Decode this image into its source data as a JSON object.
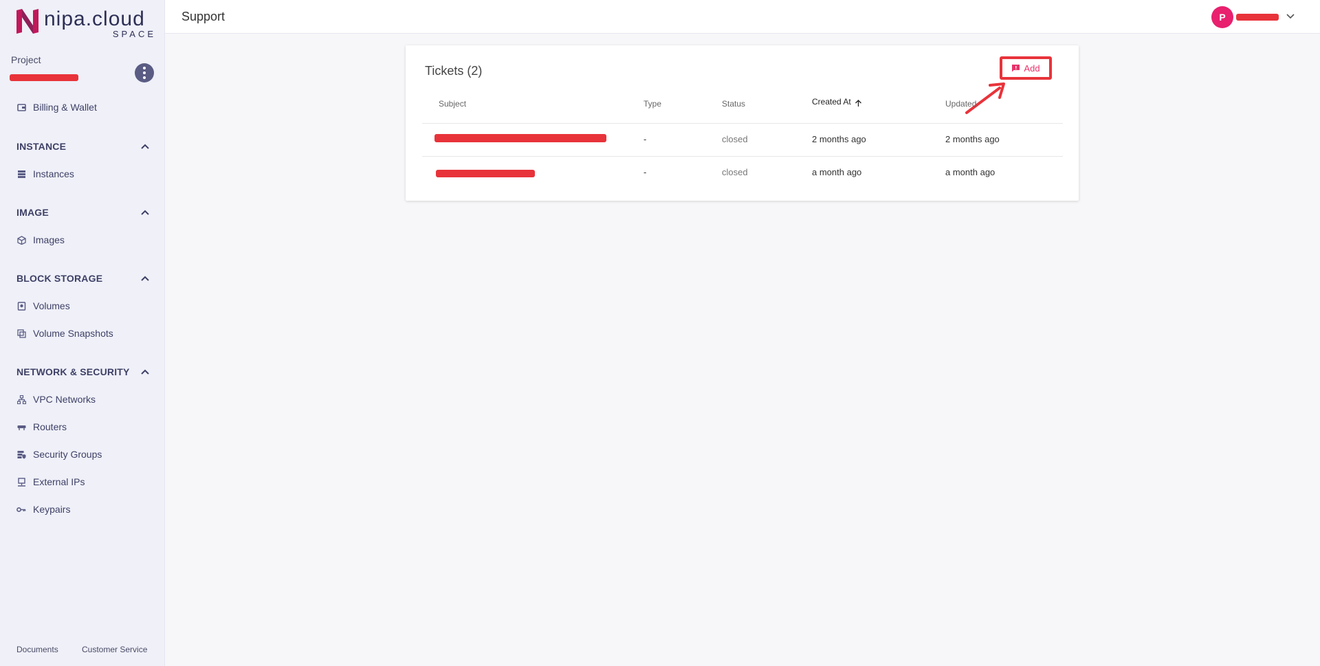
{
  "brand": {
    "name": "nipa.cloud",
    "sub": "SPACE",
    "colors": {
      "accent": "#e8206e",
      "nav": "#3e4066",
      "redaction": "#e8333a"
    }
  },
  "project": {
    "label": "Project"
  },
  "sidebar": {
    "top_items": [
      {
        "label": "Billing & Wallet",
        "icon": "wallet-icon"
      }
    ],
    "sections": [
      {
        "title": "INSTANCE",
        "items": [
          {
            "label": "Instances",
            "icon": "server-icon"
          }
        ]
      },
      {
        "title": "IMAGE",
        "items": [
          {
            "label": "Images",
            "icon": "cube-icon"
          }
        ]
      },
      {
        "title": "BLOCK STORAGE",
        "items": [
          {
            "label": "Volumes",
            "icon": "volume-icon"
          },
          {
            "label": "Volume Snapshots",
            "icon": "snapshot-icon"
          }
        ]
      },
      {
        "title": "NETWORK & SECURITY",
        "items": [
          {
            "label": "VPC Networks",
            "icon": "network-icon"
          },
          {
            "label": "Routers",
            "icon": "router-icon"
          },
          {
            "label": "Security Groups",
            "icon": "security-icon"
          },
          {
            "label": "External IPs",
            "icon": "external-ip-icon"
          },
          {
            "label": "Keypairs",
            "icon": "key-icon"
          }
        ]
      }
    ],
    "footer": {
      "documents": "Documents",
      "customer_service": "Customer Service"
    }
  },
  "header": {
    "title": "Support",
    "avatar_initial": "P"
  },
  "tickets": {
    "title": "Tickets (2)",
    "add_label": "Add",
    "columns": {
      "subject": "Subject",
      "type": "Type",
      "status": "Status",
      "created_at": "Created At",
      "updated_at": "Updated"
    },
    "rows": [
      {
        "type": "-",
        "status": "closed",
        "created_at": "2 months ago",
        "updated_at": "2 months ago"
      },
      {
        "type": "-",
        "status": "closed",
        "created_at": "a month ago",
        "updated_at": "a month ago"
      }
    ]
  }
}
